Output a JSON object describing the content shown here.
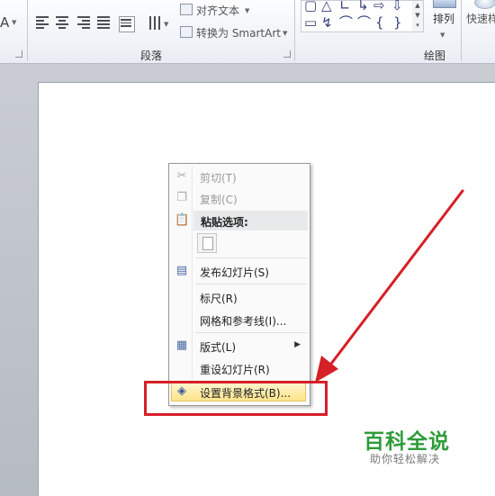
{
  "ribbon": {
    "font_glyph": "A",
    "align_text_label": "对齐文本",
    "convert_smartart_label": "转换为 SmartArt",
    "paragraph_group_label": "段落",
    "drawing_group_label": "绘图",
    "arrange_label": "排列",
    "quick_styles_label": "快速样"
  },
  "shapes": [
    "▢",
    "△",
    "∟",
    "↳",
    "⇨",
    "⇩",
    "▭",
    "↯",
    "⌒",
    "⌒",
    "{",
    "}"
  ],
  "context_menu": {
    "items": [
      {
        "label": "剪切(T)",
        "icon": "scissors-icon",
        "disabled": true
      },
      {
        "label": "复制(C)",
        "icon": "copy-icon",
        "disabled": true
      },
      {
        "label": "粘贴选项:",
        "icon": "paste-icon",
        "header": true
      },
      {
        "label": "发布幻灯片(S)",
        "icon": "publish-icon"
      },
      {
        "label": "标尺(R)"
      },
      {
        "label": "网格和参考线(I)..."
      },
      {
        "label": "版式(L)",
        "icon": "layout-icon",
        "submenu": true
      },
      {
        "label": "重设幻灯片(R)"
      },
      {
        "label": "设置背景格式(B)...",
        "icon": "format-background-icon",
        "highlighted": true
      }
    ]
  },
  "watermark": {
    "title": "百科全说",
    "subtitle": "助你轻松解决"
  },
  "colors": {
    "annotation_red": "#d61f26",
    "watermark_green": "#2e9b3a",
    "menu_highlight": "#ffe48a"
  }
}
